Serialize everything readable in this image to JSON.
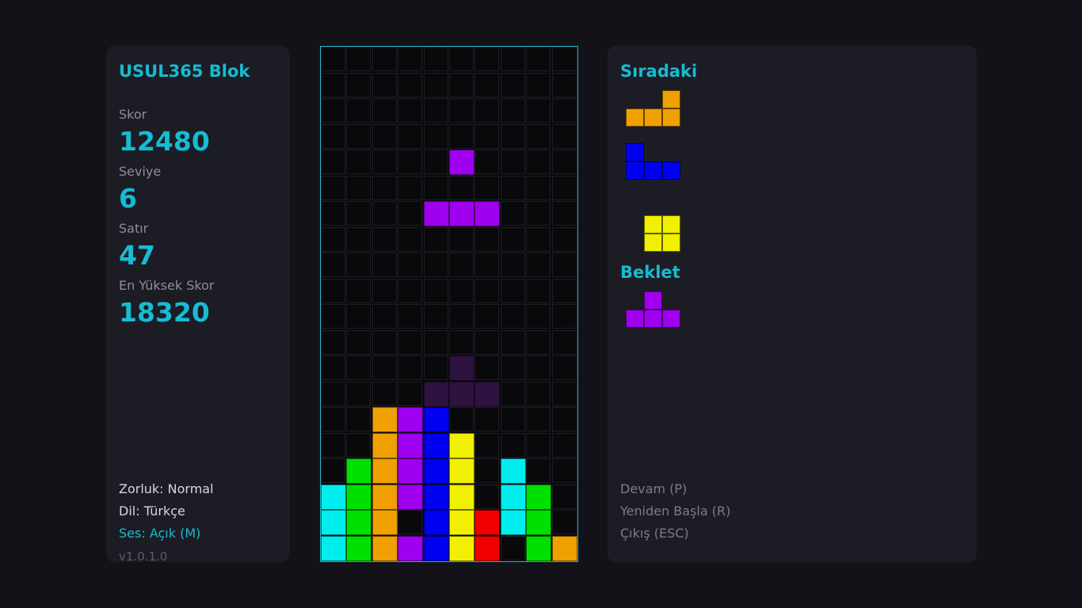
{
  "colors": {
    "accent": "#16bcd2",
    "I": "#00eded",
    "O": "#f0f000",
    "T": "#a000f0",
    "S": "#00e000",
    "Z": "#f00000",
    "J": "#0000f0",
    "L": "#f0a000",
    "ghost": "#2e1240"
  },
  "stats": {
    "app_title": "USUL365 Blok",
    "score_label": "Skor",
    "score": "12480",
    "level_label": "Seviye",
    "level": "6",
    "lines_label": "Satır",
    "lines": "47",
    "highscore_label": "En Yüksek Skor",
    "highscore": "18320"
  },
  "settings": {
    "difficulty": "Zorluk: Normal",
    "language": "Dil: Türkçe",
    "sound": "Ses: Açık (M)",
    "version": "v1.0.1.0"
  },
  "queue": {
    "next_title": "Sıradaki",
    "hold_title": "Beklet",
    "next_pieces": [
      "L",
      "J",
      "O"
    ],
    "hold_piece": "T"
  },
  "menu": {
    "resume": "Devam (P)",
    "restart": "Yeniden Başla (R)",
    "exit": "Çıkış (ESC)"
  },
  "board": {
    "columns": 10,
    "rows": 20,
    "locked": [
      "..........",
      "..........",
      "..........",
      "..........",
      "..........",
      "..........",
      "..........",
      "..........",
      "..........",
      "..........",
      "..........",
      "..........",
      "..........",
      "..........",
      "..LTJ.....",
      "..LTJO....",
      ".SLTJO.I..",
      "ISLTJO.IS.",
      "ISL.JOZIS.",
      "ISLTJOZ.SL"
    ],
    "active_piece": {
      "type": "T",
      "cells": [
        [
          4,
          5
        ],
        [
          6,
          4
        ],
        [
          6,
          5
        ],
        [
          6,
          6
        ]
      ]
    },
    "ghost_piece": {
      "cells": [
        [
          12,
          5
        ],
        [
          13,
          4
        ],
        [
          13,
          5
        ],
        [
          13,
          6
        ]
      ]
    }
  }
}
